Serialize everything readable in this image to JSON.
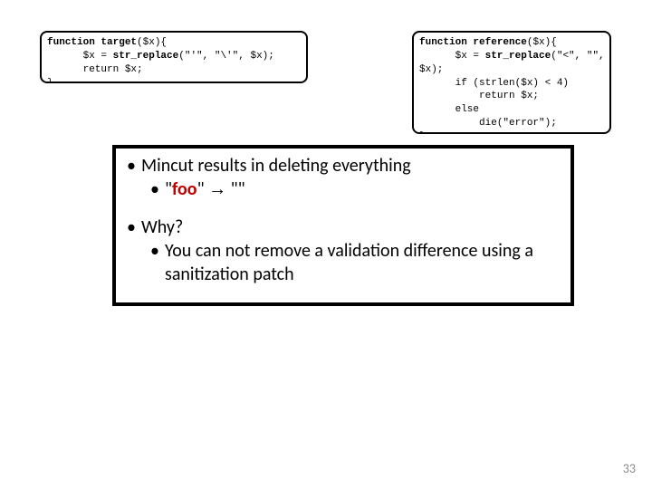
{
  "code_left": {
    "l1a": "function ",
    "l1b": "target",
    "l1c": "($x){",
    "l2a": "      $x = ",
    "l2b": "str_replace",
    "l2c": "(\"'\", \"\\'\", $x);",
    "l3": "      return $x;",
    "l4": "}"
  },
  "code_right": {
    "l1a": "function ",
    "l1b": "reference",
    "l1c": "($x){",
    "l2a": "      $x = ",
    "l2b": "str_replace",
    "l2c": "(\"<\", \"\",",
    "l3": "$x);",
    "l4": "      if (strlen($x) < 4)",
    "l5": "          return $x;",
    "l6": "      else",
    "l7": "          die(\"error\");",
    "l8": "}"
  },
  "bullets": {
    "b1": "Mincut results in deleting everything",
    "b1s_pre": "\"",
    "b1s_foo": "foo",
    "b1s_mid": "\"  ",
    "b1s_arrow": "→",
    "b1s_post": "   \"\"",
    "b2": "Why?",
    "b2s": "You can not remove a validation difference using a sanitization patch"
  },
  "page_number": "33"
}
